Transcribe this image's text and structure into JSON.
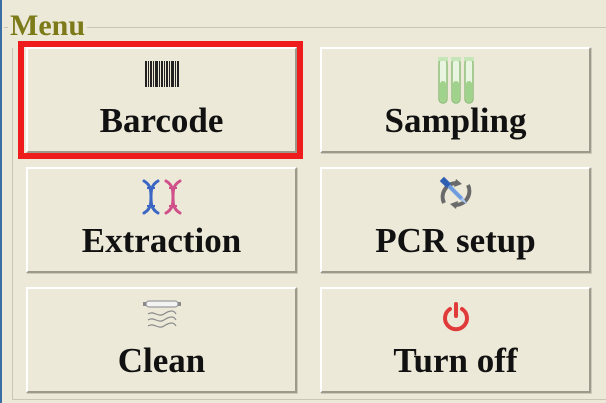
{
  "menu": {
    "title": "Menu",
    "buttons": [
      {
        "label": "Barcode",
        "icon": "barcode-icon",
        "selected": true
      },
      {
        "label": "Sampling",
        "icon": "test-tubes-icon",
        "selected": false
      },
      {
        "label": "Extraction",
        "icon": "dna-icon",
        "selected": false
      },
      {
        "label": "PCR setup",
        "icon": "pipette-icon",
        "selected": false
      },
      {
        "label": "Clean",
        "icon": "uv-lamp-icon",
        "selected": false
      },
      {
        "label": "Turn off",
        "icon": "power-icon",
        "selected": false
      }
    ]
  },
  "colors": {
    "title": "#7c7a19",
    "selection": "#ee1c1c",
    "power": "#e03a3a",
    "dna_blue": "#3b66c4",
    "dna_pink": "#d0508a",
    "tube_green": "#9fd28a"
  }
}
